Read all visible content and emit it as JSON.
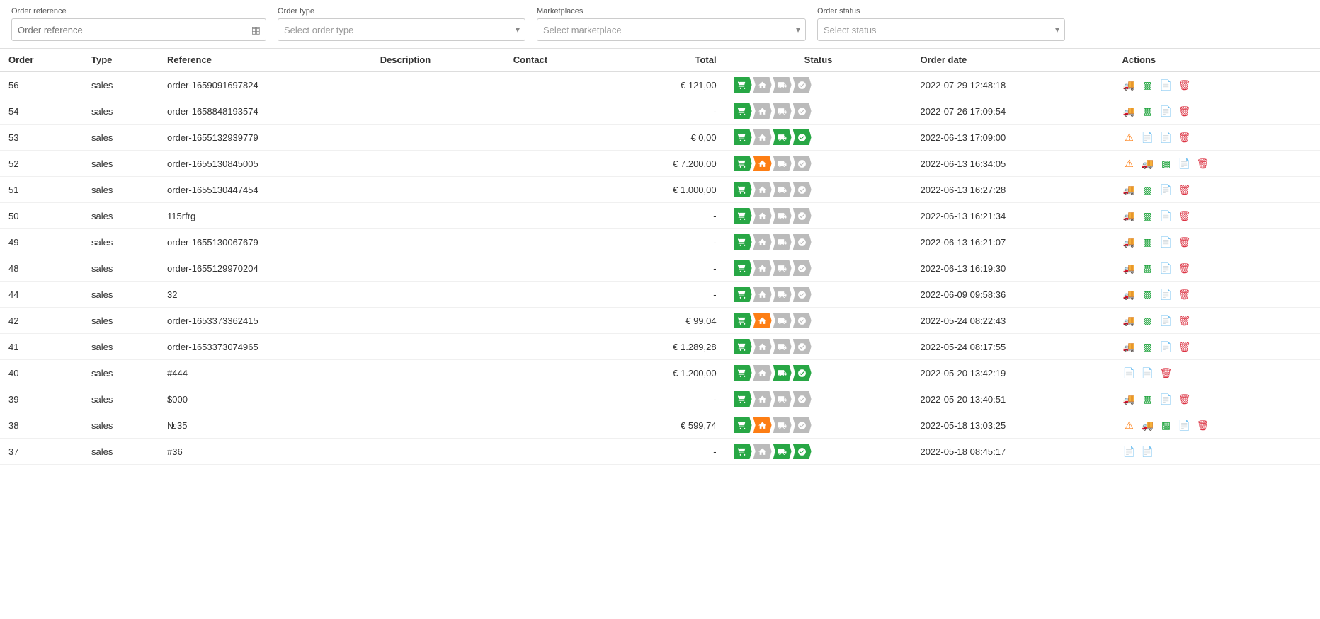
{
  "filters": {
    "order_reference_label": "Order reference",
    "order_reference_placeholder": "Order reference",
    "order_type_label": "Order type",
    "order_type_placeholder": "Select order type",
    "marketplaces_label": "Marketplaces",
    "marketplaces_placeholder": "Select marketplace",
    "order_status_label": "Order status",
    "order_status_placeholder": "Select status"
  },
  "table": {
    "headers": [
      "Order",
      "Type",
      "Reference",
      "Description",
      "Contact",
      "Total",
      "Status",
      "Order date",
      "Actions"
    ],
    "rows": [
      {
        "id": 56,
        "type": "sales",
        "reference": "order-1659091697824",
        "description": "",
        "contact": "",
        "total": "€ 121,00",
        "status": [
          1,
          0,
          0,
          0
        ],
        "date": "2022-07-29 12:48:18",
        "actions": [
          "truck",
          "chart",
          "file",
          "delete"
        ]
      },
      {
        "id": 54,
        "type": "sales",
        "reference": "order-1658848193574",
        "description": "",
        "contact": "",
        "total": "-",
        "status": [
          1,
          0,
          0,
          0
        ],
        "date": "2022-07-26 17:09:54",
        "actions": [
          "truck",
          "chart",
          "file",
          "delete"
        ]
      },
      {
        "id": 53,
        "type": "sales",
        "reference": "order-1655132939779",
        "description": "",
        "contact": "",
        "total": "€ 0,00",
        "status": [
          1,
          0,
          1,
          1
        ],
        "date": "2022-06-13 17:09:00",
        "actions": [
          "warning",
          "file",
          "file_orange",
          "delete"
        ]
      },
      {
        "id": 52,
        "type": "sales",
        "reference": "order-1655130845005",
        "description": "",
        "contact": "",
        "total": "€ 7.200,00",
        "status": [
          1,
          2,
          0,
          0
        ],
        "date": "2022-06-13 16:34:05",
        "actions": [
          "warning",
          "truck",
          "chart",
          "file",
          "delete"
        ]
      },
      {
        "id": 51,
        "type": "sales",
        "reference": "order-1655130447454",
        "description": "",
        "contact": "",
        "total": "€ 1.000,00",
        "status": [
          1,
          0,
          0,
          0
        ],
        "date": "2022-06-13 16:27:28",
        "actions": [
          "truck",
          "chart",
          "file",
          "delete"
        ]
      },
      {
        "id": 50,
        "type": "sales",
        "reference": "115rfrg",
        "description": "",
        "contact": "",
        "total": "-",
        "status": [
          1,
          0,
          0,
          0
        ],
        "date": "2022-06-13 16:21:34",
        "actions": [
          "truck",
          "chart",
          "file",
          "delete"
        ]
      },
      {
        "id": 49,
        "type": "sales",
        "reference": "order-1655130067679",
        "description": "",
        "contact": "",
        "total": "-",
        "status": [
          1,
          0,
          0,
          0
        ],
        "date": "2022-06-13 16:21:07",
        "actions": [
          "truck",
          "chart",
          "file",
          "delete"
        ]
      },
      {
        "id": 48,
        "type": "sales",
        "reference": "order-1655129970204",
        "description": "",
        "contact": "",
        "total": "-",
        "status": [
          1,
          0,
          0,
          0
        ],
        "date": "2022-06-13 16:19:30",
        "actions": [
          "truck",
          "chart",
          "file",
          "delete"
        ]
      },
      {
        "id": 44,
        "type": "sales",
        "reference": "32",
        "description": "",
        "contact": "",
        "total": "-",
        "status": [
          1,
          0,
          0,
          0
        ],
        "date": "2022-06-09 09:58:36",
        "actions": [
          "truck",
          "chart",
          "file",
          "delete"
        ]
      },
      {
        "id": 42,
        "type": "sales",
        "reference": "order-1653373362415",
        "description": "",
        "contact": "",
        "total": "€ 99,04",
        "status": [
          1,
          2,
          0,
          0
        ],
        "date": "2022-05-24 08:22:43",
        "actions": [
          "truck",
          "chart",
          "file",
          "delete"
        ]
      },
      {
        "id": 41,
        "type": "sales",
        "reference": "order-1653373074965",
        "description": "",
        "contact": "",
        "total": "€ 1.289,28",
        "status": [
          1,
          0,
          0,
          0
        ],
        "date": "2022-05-24 08:17:55",
        "actions": [
          "truck",
          "chart",
          "file",
          "delete"
        ]
      },
      {
        "id": 40,
        "type": "sales",
        "reference": "#444",
        "description": "",
        "contact": "",
        "total": "€ 1.200,00",
        "status": [
          1,
          0,
          1,
          1
        ],
        "date": "2022-05-20 13:42:19",
        "actions": [
          "file",
          "file_orange",
          "delete"
        ]
      },
      {
        "id": 39,
        "type": "sales",
        "reference": "$000",
        "description": "",
        "contact": "",
        "total": "-",
        "status": [
          1,
          0,
          0,
          0
        ],
        "date": "2022-05-20 13:40:51",
        "actions": [
          "truck",
          "chart",
          "file",
          "delete"
        ]
      },
      {
        "id": 38,
        "type": "sales",
        "reference": "№35",
        "description": "",
        "contact": "",
        "total": "€ 599,74",
        "status": [
          1,
          2,
          0,
          0
        ],
        "date": "2022-05-18 13:03:25",
        "actions": [
          "warning",
          "truck",
          "chart",
          "file",
          "delete"
        ]
      },
      {
        "id": 37,
        "type": "sales",
        "reference": "#36",
        "description": "",
        "contact": "",
        "total": "-",
        "status": [
          1,
          0,
          1,
          1
        ],
        "date": "2022-05-18 08:45:17",
        "actions": [
          "file",
          "file_orange"
        ]
      }
    ]
  }
}
